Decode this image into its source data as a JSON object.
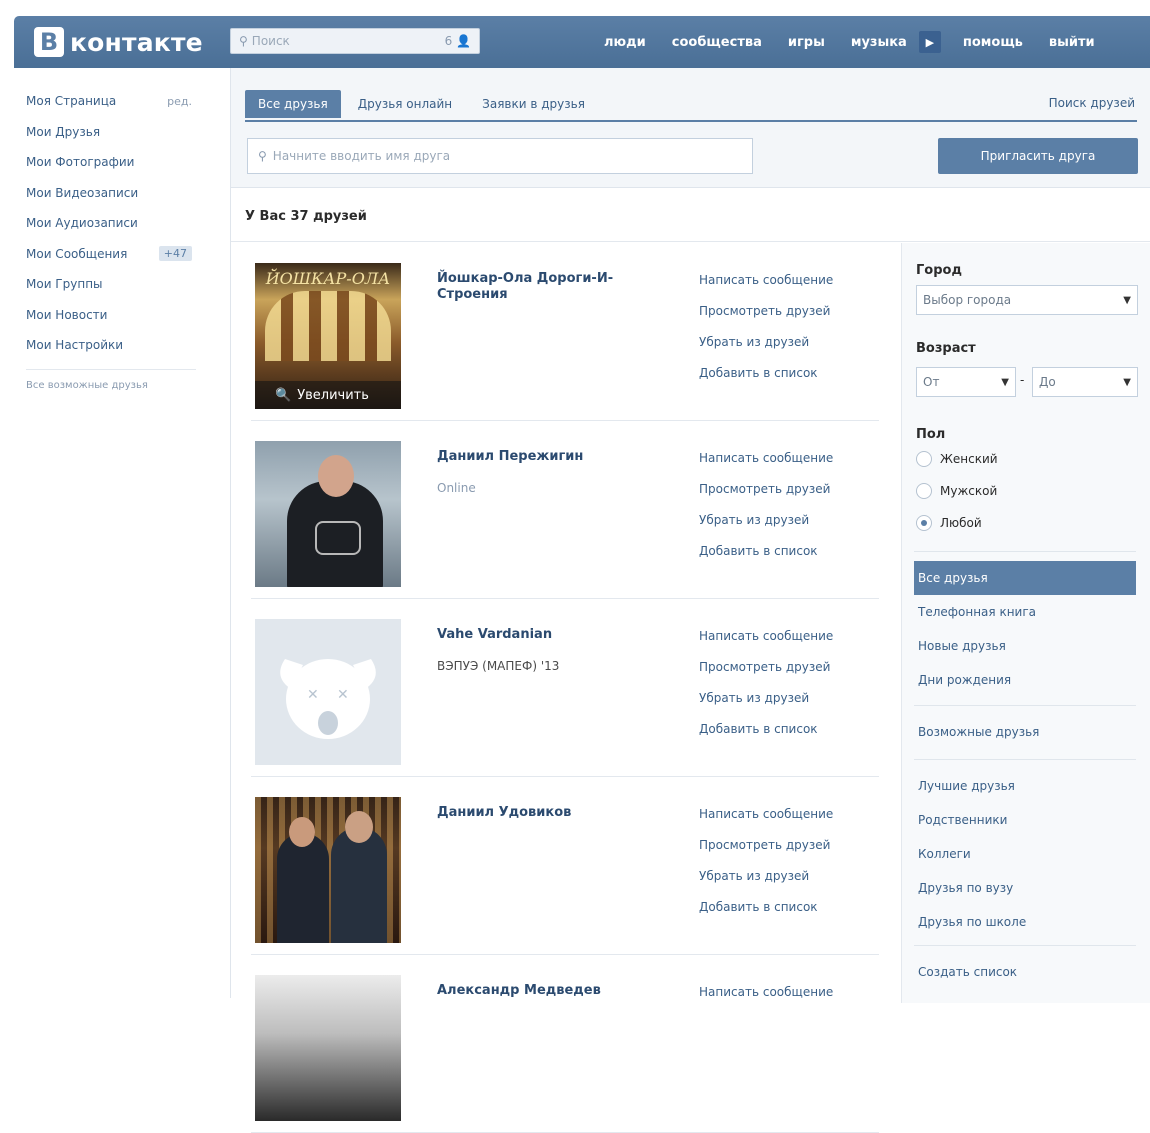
{
  "header": {
    "logo_letter": "В",
    "logo_text": "контакте",
    "search_placeholder": "Поиск",
    "search_count": "6",
    "nav": [
      "люди",
      "сообщества",
      "игры",
      "музыка",
      "помощь",
      "выйти"
    ]
  },
  "leftmenu": {
    "items": [
      {
        "label": "Моя Страница",
        "extra": "ред."
      },
      {
        "label": "Мои Друзья"
      },
      {
        "label": "Мои Фотографии"
      },
      {
        "label": "Мои Видеозаписи"
      },
      {
        "label": "Мои Аудиозаписи"
      },
      {
        "label": "Мои Сообщения",
        "badge": "+47"
      },
      {
        "label": "Мои Группы"
      },
      {
        "label": "Мои Новости"
      },
      {
        "label": "Мои Настройки"
      }
    ],
    "footer": "Все возможные друзья"
  },
  "tabs": {
    "items": [
      "Все друзья",
      "Друзья онлайн",
      "Заявки в друзья"
    ],
    "active": 0,
    "find": "Поиск друзей"
  },
  "friend_search": {
    "placeholder": "Начните вводить имя друга",
    "invite": "Пригласить друга"
  },
  "count_text": "У Вас 37 друзей",
  "friend_actions": [
    "Написать сообщение",
    "Просмотреть друзей",
    "Убрать из друзей",
    "Добавить в список"
  ],
  "friends": [
    {
      "name": "Йошкар-Ола Дороги-И-Строения",
      "sub": "",
      "photo_caption": "Увеличить"
    },
    {
      "name": "Даниил Пережигин",
      "sub": "Online"
    },
    {
      "name": "Vahe Vardanian",
      "sub": "ВЭПУЭ (МАПЕФ) '13"
    },
    {
      "name": "Даниил Удовиков",
      "sub": ""
    },
    {
      "name": "Александр Медведев",
      "sub": ""
    }
  ],
  "filters": {
    "city_label": "Город",
    "city_value": "Выбор города",
    "age_label": "Возраст",
    "age_from": "От",
    "age_dash": "-",
    "age_to": "До",
    "sex_label": "Пол",
    "sex_options": [
      "Женский",
      "Мужской",
      "Любой"
    ],
    "sex_selected": 2,
    "menu_group1": [
      "Все друзья",
      "Телефонная книга",
      "Новые друзья",
      "Дни рождения"
    ],
    "menu_group2": [
      "Возможные друзья"
    ],
    "menu_group3": [
      "Лучшие друзья",
      "Родственники",
      "Коллеги",
      "Друзья по вузу",
      "Друзья по школе"
    ],
    "menu_group4": [
      "Создать список"
    ]
  },
  "colors": {
    "brand": "#5b7fa6",
    "link": "#3a5f87"
  }
}
